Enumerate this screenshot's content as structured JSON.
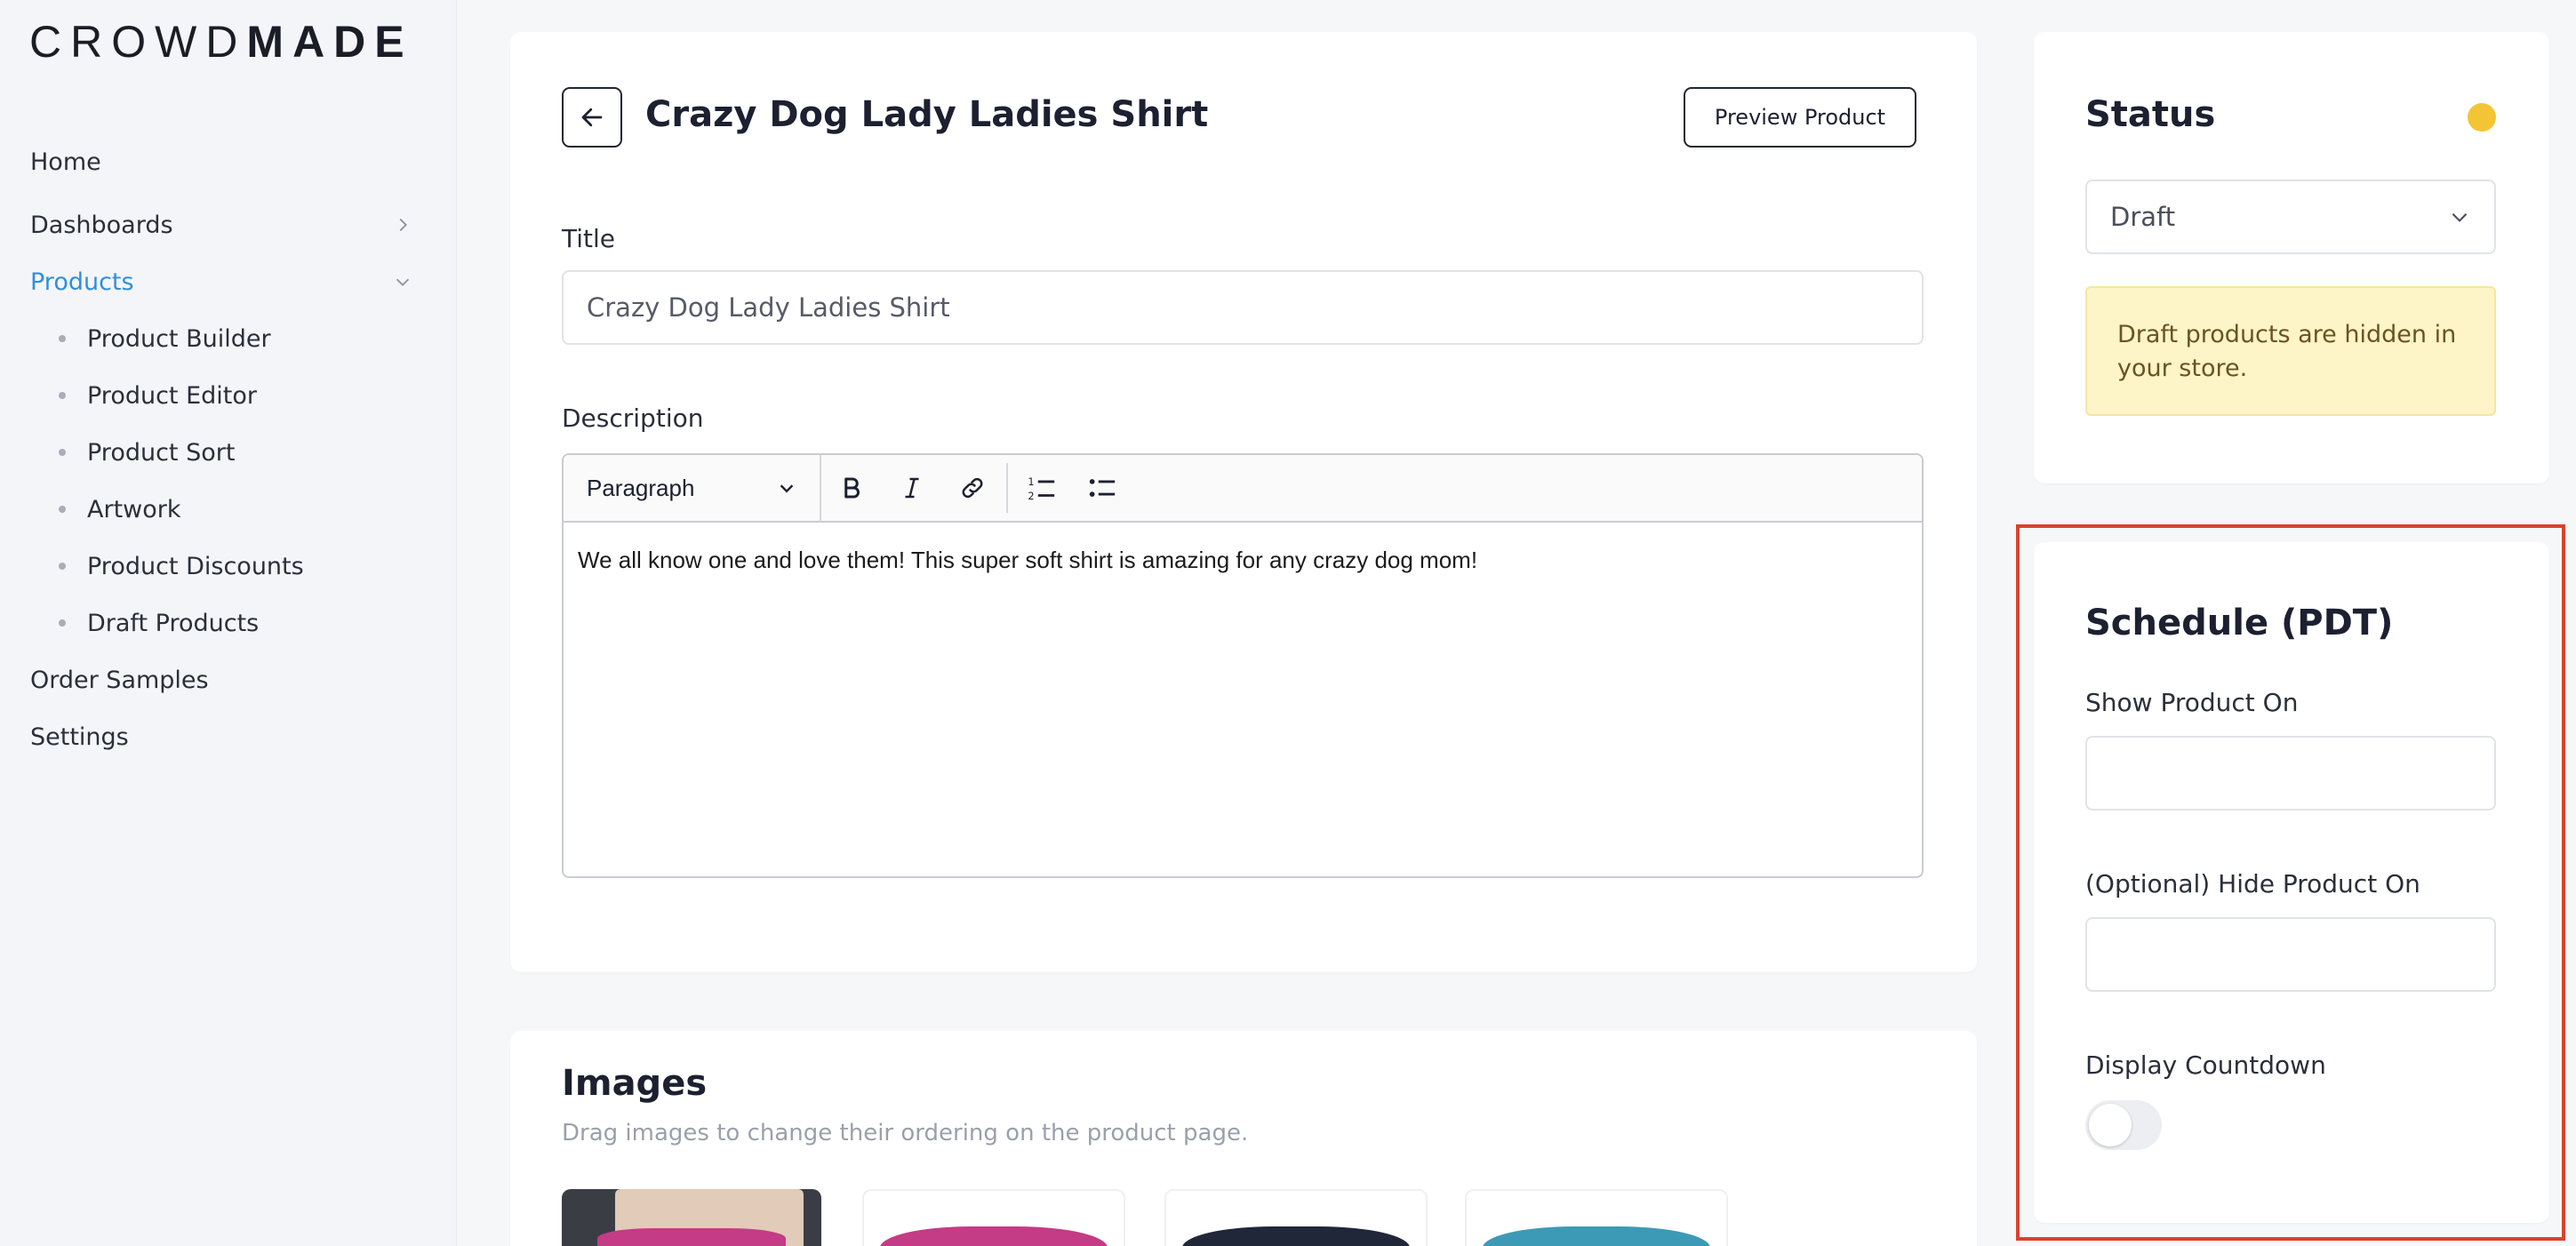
{
  "logo": {
    "thin": "CROWD",
    "bold": "MADE"
  },
  "sidebar": {
    "items": [
      {
        "label": "Home"
      },
      {
        "label": "Dashboards"
      },
      {
        "label": "Products"
      },
      {
        "label": "Order Samples"
      },
      {
        "label": "Settings"
      }
    ],
    "product_sub_items": [
      {
        "label": "Product Builder"
      },
      {
        "label": "Product Editor"
      },
      {
        "label": "Product Sort"
      },
      {
        "label": "Artwork"
      },
      {
        "label": "Product Discounts"
      },
      {
        "label": "Draft Products"
      }
    ],
    "active_color": "#2f8fdd"
  },
  "header": {
    "product_title": "Crazy Dog Lady Ladies Shirt",
    "preview_label": "Preview Product"
  },
  "form": {
    "title_label": "Title",
    "title_value": "Crazy Dog Lady Ladies Shirt",
    "description_label": "Description",
    "format_option": "Paragraph",
    "description_text": "We all know one and love them! This super soft shirt is amazing for any crazy dog mom!"
  },
  "images": {
    "title": "Images",
    "hint": "Drag images to change their ordering on the product page.",
    "shirt_colors": [
      "#c43b86",
      "#1f2739",
      "#3d9ab6"
    ]
  },
  "status": {
    "title": "Status",
    "value": "Draft",
    "notice": "Draft products are hidden in your store.",
    "dot_color": "#f3c534"
  },
  "schedule": {
    "title": "Schedule (PDT)",
    "show_label": "Show Product On",
    "show_value": "",
    "hide_label": "(Optional) Hide Product On",
    "hide_value": "",
    "countdown_label": "Display Countdown",
    "countdown_enabled": false
  }
}
